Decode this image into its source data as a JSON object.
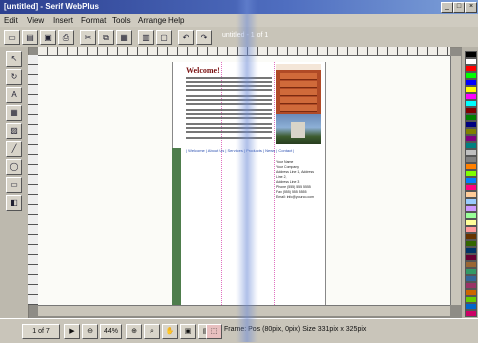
{
  "window": {
    "title": "[untitled] - Serif WebPlus"
  },
  "menu": [
    "Edit",
    "View",
    "Insert",
    "Format",
    "Tools",
    "Arrange",
    "Help"
  ],
  "toolbar": {
    "doc_title": "untitled - 1 of 1"
  },
  "page": {
    "heading": "Welcome!",
    "nav_links_text": "| Welcome | About Us | Services | Products | News | Contact |",
    "address_lines": [
      "Your Name",
      "Your Company",
      "Address Line 1, Address Line 2,",
      "Address Line 3",
      "Phone (555) 555 5555",
      "Fax (555) 555 5555",
      "Email: info@yourco.com"
    ]
  },
  "status": {
    "page_indicator": "1 of 7",
    "zoom": "44%",
    "frame_info": "Frame: Pos (80pix, 0pix) Size 331pix x 325pix"
  },
  "colors": {
    "title_bar": "#2c3f8f",
    "sidebar_green": "#4e7d4c",
    "nav_orange": "#b04a26",
    "guide_pink": "#e070c0"
  },
  "palette": [
    "#000000",
    "#ffffff",
    "#ff0000",
    "#00ff00",
    "#0000ff",
    "#ffff00",
    "#ff00ff",
    "#00ffff",
    "#800000",
    "#008000",
    "#000080",
    "#808000",
    "#800080",
    "#008080",
    "#c0c0c0",
    "#808080",
    "#ff8000",
    "#80ff00",
    "#0080ff",
    "#ff0080",
    "#ffcc99",
    "#99ccff",
    "#cc99ff",
    "#99ff99",
    "#ffff99",
    "#ff9999",
    "#663300",
    "#336600",
    "#003366",
    "#660033",
    "#996633",
    "#339966",
    "#336699",
    "#993366",
    "#cc6600",
    "#66cc00",
    "#0066cc",
    "#cc0066"
  ],
  "icons": {
    "min": "minimize-icon",
    "max": "maximize-icon",
    "close": "close-icon"
  }
}
